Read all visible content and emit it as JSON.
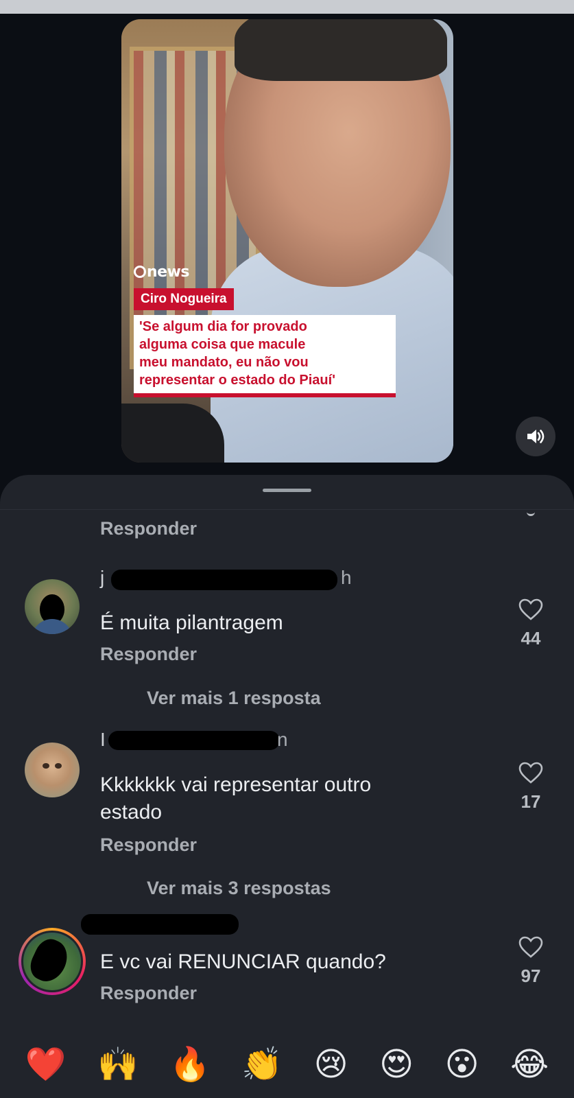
{
  "video": {
    "channel": "news",
    "name_tag": "Ciro Nogueira",
    "quote_lines": [
      "'Se algum dia for provado",
      "alguma coisa que macule",
      "meu mandato, eu não vou",
      "representar o estado do Piauí'"
    ]
  },
  "comments_sheet": {
    "top_reply_label": "Responder",
    "comments": [
      {
        "username_visible": "j",
        "time_suffix": "h",
        "text": "É muita pilantragem",
        "likes": "44",
        "reply_label": "Responder",
        "more_replies": "Ver mais 1 resposta"
      },
      {
        "username_visible": "I",
        "time_suffix": "n",
        "text_lines": [
          "Kkkkkkk vai representar outro",
          "estado"
        ],
        "likes": "17",
        "reply_label": "Responder",
        "more_replies": "Ver mais 3 respostas"
      },
      {
        "text": "E vc vai RENUNCIAR quando?",
        "likes": "97",
        "reply_label": "Responder"
      }
    ]
  },
  "reactions": [
    "❤️",
    "🙌",
    "🔥",
    "👏",
    "😢",
    "😍",
    "😮",
    "😂"
  ],
  "colors": {
    "background": "#0b0e14",
    "sheet": "#21242b",
    "news_red": "#c8102e"
  }
}
